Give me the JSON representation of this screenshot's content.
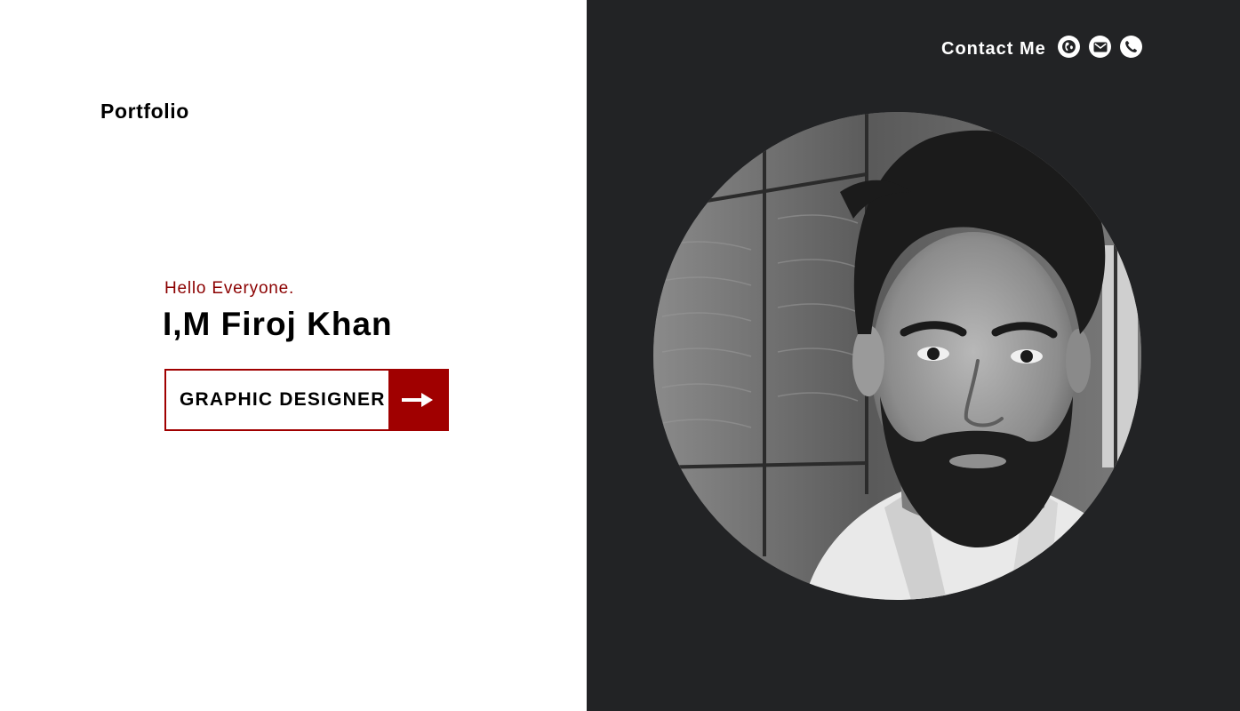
{
  "brand": {
    "logo_text": "Portfolio"
  },
  "hero": {
    "greeting": "Hello Everyone.",
    "headline": "I,M Firoj Khan",
    "role_button": {
      "label": "GRAPHIC DESIGNER",
      "icon": "arrow-right-icon"
    }
  },
  "contact": {
    "label": "Contact Me",
    "icons": [
      "globe-icon",
      "mail-icon",
      "phone-icon"
    ]
  },
  "profile": {
    "image": "profile-photo"
  },
  "colors": {
    "accent": "#a00000",
    "greeting": "#8b0000",
    "dark_panel": "#222325",
    "light_panel": "#ffffff"
  }
}
